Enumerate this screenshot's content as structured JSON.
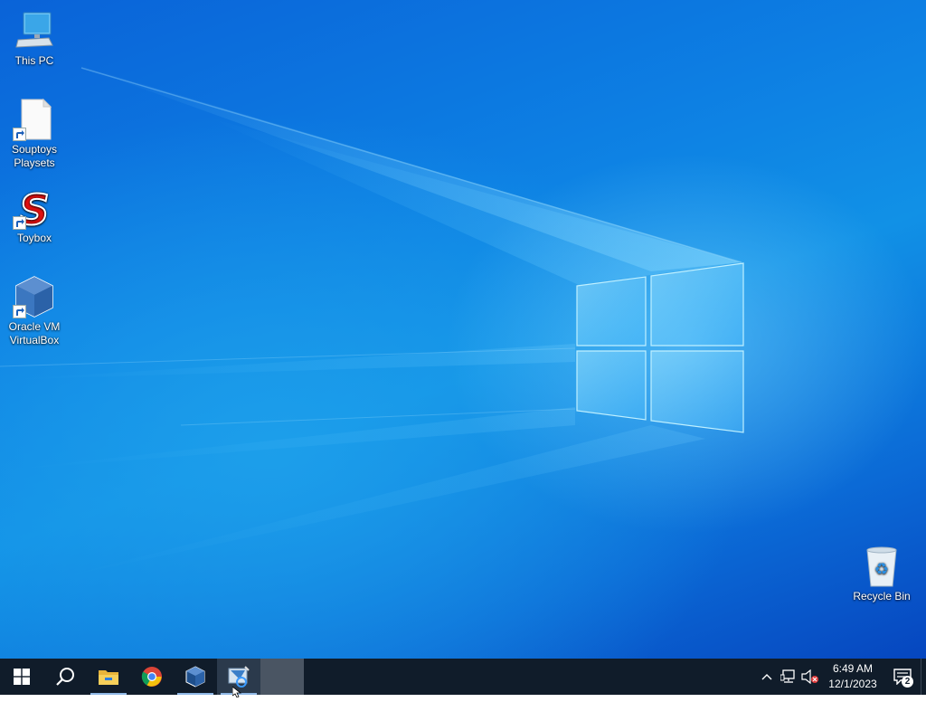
{
  "desktop": {
    "icons": [
      {
        "label": "This PC",
        "icon": "computer-icon"
      },
      {
        "label": "Souptoys\nPlaysets",
        "icon": "blank-file-icon"
      },
      {
        "label": "Toybox",
        "icon": "red-s-icon"
      },
      {
        "label": "Oracle VM\nVirtualBox",
        "icon": "virtualbox-icon"
      },
      {
        "label": "Recycle Bin",
        "icon": "recycle-bin-icon"
      }
    ]
  },
  "taskbar": {
    "buttons": [
      {
        "name": "start-button",
        "icon": "windows-logo-icon"
      },
      {
        "name": "search-button",
        "icon": "search-icon"
      },
      {
        "name": "file-explorer-button",
        "icon": "folder-icon"
      },
      {
        "name": "chrome-button",
        "icon": "chrome-icon"
      },
      {
        "name": "virtualbox-button",
        "icon": "virtualbox-icon"
      },
      {
        "name": "app-button",
        "icon": "app-icon"
      }
    ],
    "clock": {
      "time": "6:49 AM",
      "date": "12/1/2023"
    },
    "notifications": {
      "count": "2"
    }
  },
  "colors": {
    "taskbar": "#101c2a",
    "accent": "#1191e6"
  }
}
